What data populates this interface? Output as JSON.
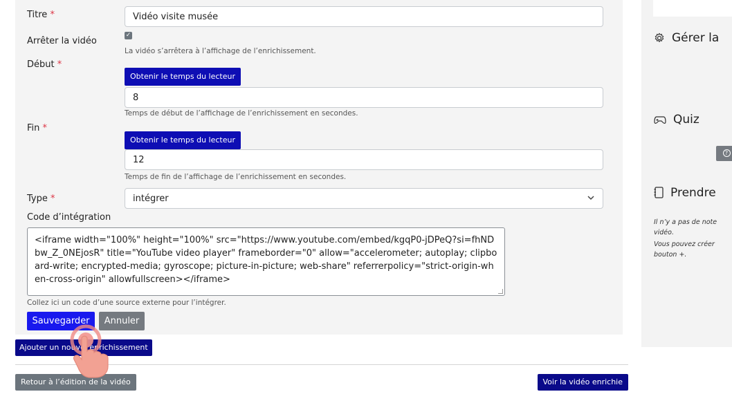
{
  "form": {
    "title_label": "Titre",
    "required_mark": "*",
    "title_value": "Vidéo visite musée",
    "stop_label": "Arrêter la vidéo",
    "stop_checked": true,
    "stop_hint": "La vidéo s’arrêtera à l’affichage de l’enrichissement.",
    "start_label": "Début",
    "get_time_label": "Obtenir le temps du lecteur",
    "start_value": "8",
    "start_hint": "Temps de début de l’affichage de l’enrichissement en secondes.",
    "end_label": "Fin",
    "end_value": "12",
    "end_hint": "Temps de fin de l’affichage de l’enrichissement en secondes.",
    "type_label": "Type",
    "type_value": "intégrer",
    "embed_label": "Code d’intégration",
    "embed_value": "<iframe width=\"100%\" height=\"100%\" src=\"https://www.youtube.com/embed/kgqP0-jDPeQ?si=fhNDbw_Z_0NEjosR\" title=\"YouTube video player\" frameborder=\"0\" allow=\"accelerometer; autoplay; clipboard-write; encrypted-media; gyroscope; picture-in-picture; web-share\" referrerpolicy=\"strict-origin-when-cross-origin\" allowfullscreen></iframe>",
    "embed_hint": "Collez ici un code d’une source externe pour l’intégrer.",
    "save_label": "Sauvegarder",
    "cancel_label": "Annuler"
  },
  "actions": {
    "add_label": "Ajouter un nouvel enrichissement",
    "back_label": "Retour à l’édition de la vidéo",
    "view_label": "Voir la vidéo enrichie"
  },
  "sidebar": {
    "manage_title": "Gérer la",
    "quiz_title": "Quiz",
    "help_icon_glyph": "?",
    "notes_title": "Prendre",
    "notes_line1": "Il n’y a pas de note",
    "notes_line2": "vidéo.",
    "notes_line3": "Vous pouvez créer",
    "notes_line4": "bouton +."
  },
  "colors": {
    "primary": "#0e0eb4",
    "save": "#1919ee",
    "secondary": "#757a80",
    "required": "#dc3545"
  },
  "icons": [
    "gear-icon",
    "gamepad-icon",
    "notes-icon",
    "help-icon",
    "chevron-down-icon",
    "check-icon",
    "hand-pointer-icon"
  ]
}
